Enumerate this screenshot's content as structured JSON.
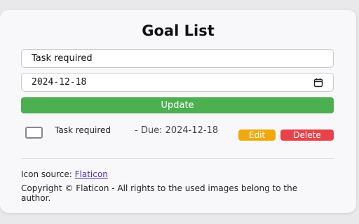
{
  "header": {
    "title": "Goal List"
  },
  "form": {
    "task_value": "Task required",
    "date_value": "2024-12-18",
    "update_label": "Update"
  },
  "goals": [
    {
      "text": "Task required",
      "due": "- Due: 2024-12-18",
      "edit_label": "Edit",
      "delete_label": "Delete",
      "checked": false
    }
  ],
  "footer": {
    "icon_source_label": "Icon source:",
    "icon_source_link": "Flaticon",
    "copyright": "Copyright © Flaticon - All rights to the used images belong to the author."
  },
  "colors": {
    "update": "#4caf50",
    "edit": "#f0a90c",
    "delete": "#e8424a",
    "link": "#4a2dbd"
  },
  "icons": {
    "date_picker": "calendar-icon"
  }
}
